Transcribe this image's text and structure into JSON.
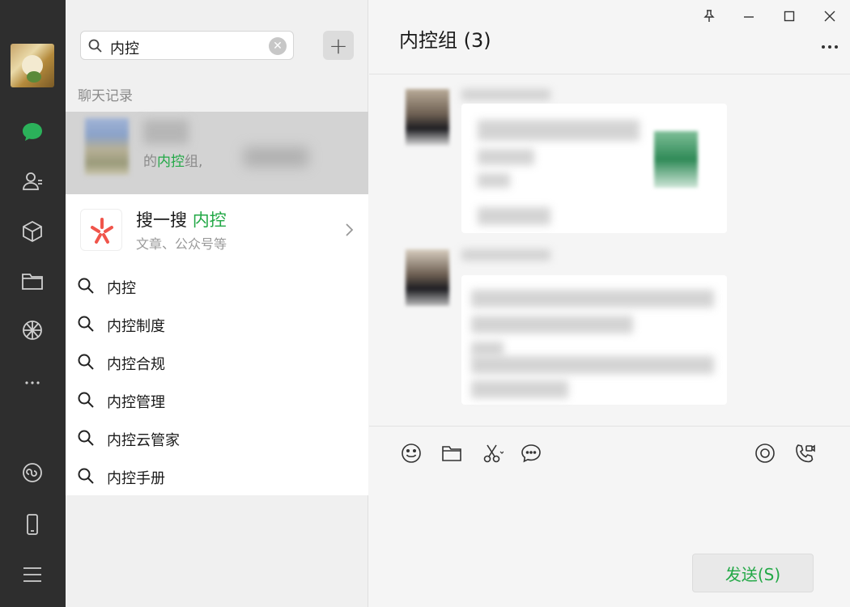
{
  "search": {
    "query": "内控",
    "clear_icon": "clear-icon",
    "add_label": "+"
  },
  "chat_history": {
    "section_label": "聊天记录",
    "result": {
      "snippet_prefix": "的",
      "snippet_highlight": "内控",
      "snippet_suffix": "组,"
    }
  },
  "souyisou": {
    "title_prefix": "搜一搜 ",
    "title_highlight": "内控",
    "subtitle": "文章、公众号等"
  },
  "suggestions": [
    {
      "label": "内控"
    },
    {
      "label": "内控制度"
    },
    {
      "label": "内控合规"
    },
    {
      "label": "内控管理"
    },
    {
      "label": "内控云管家"
    },
    {
      "label": "内控手册"
    }
  ],
  "chat": {
    "title": "内控组 (3)",
    "send_label": "发送(S)"
  },
  "colors": {
    "accent_green": "#22a846",
    "rail_bg": "#2e2e2e",
    "selected_row": "#d3d3d3"
  },
  "icons": {
    "rail": [
      "chat-icon",
      "contacts-icon",
      "cube-icon",
      "folder-icon",
      "moments-icon",
      "more-icon",
      "miniprogram-icon",
      "phone-icon",
      "menu-icon"
    ],
    "toolbar": [
      "emoji-icon",
      "file-icon",
      "scissors-icon",
      "comment-icon",
      "live-icon",
      "video-call-icon"
    ],
    "window": [
      "pin-icon",
      "minimize-icon",
      "maximize-icon",
      "close-icon"
    ]
  }
}
